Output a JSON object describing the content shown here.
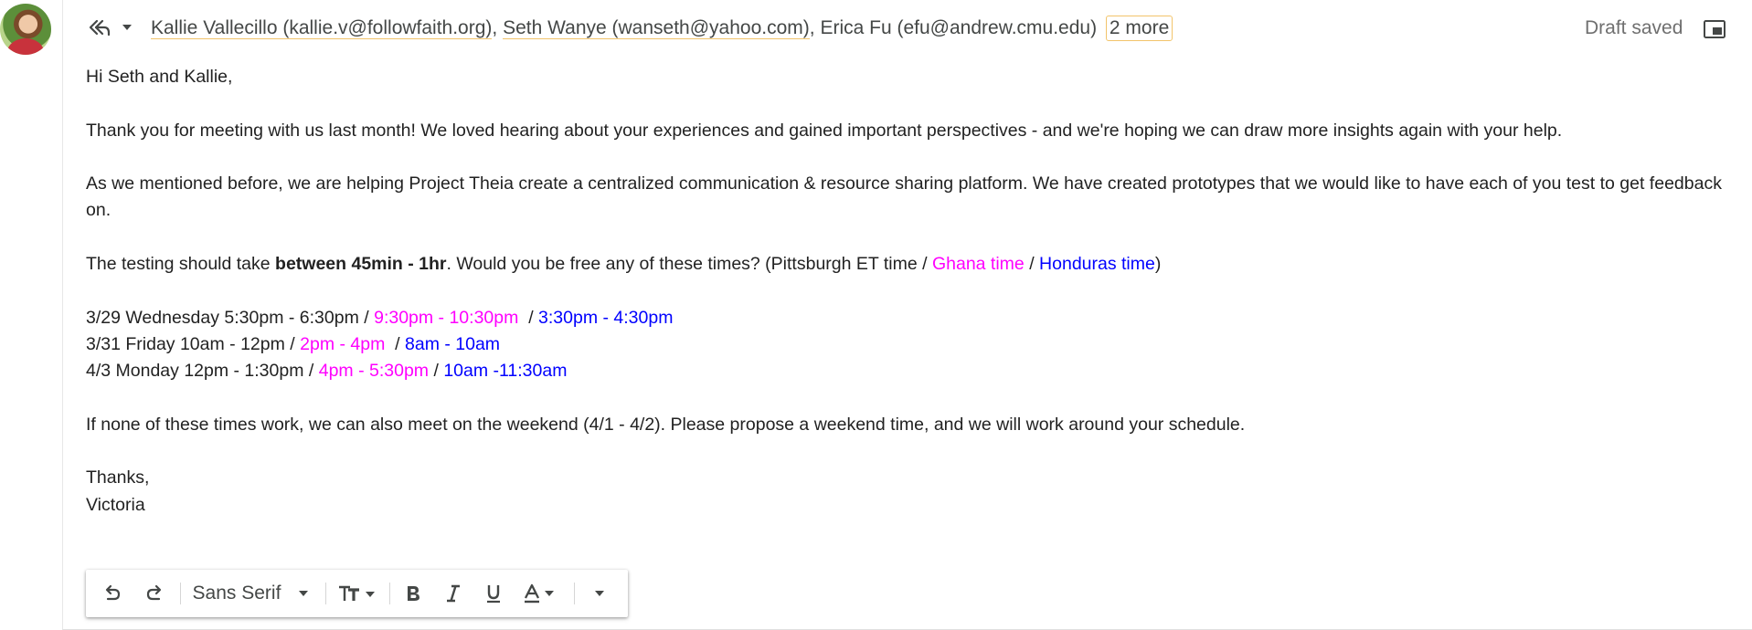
{
  "header": {
    "recipients": [
      {
        "name": "Kallie Vallecillo",
        "email": "kallie.v@followfaith.org",
        "display": "Kallie Vallecillo (kallie.v@followfaith.org)"
      },
      {
        "name": "Seth Wanye",
        "email": "wanseth@yahoo.com",
        "display": "Seth Wanye (wanseth@yahoo.com)"
      },
      {
        "name": "Erica Fu",
        "email": "efu@andrew.cmu.edu",
        "display": "Erica Fu (efu@andrew.cmu.edu)"
      }
    ],
    "separator": ", ",
    "more_label": "2 more",
    "status": "Draft saved"
  },
  "body": {
    "greeting": "Hi Seth and Kallie,",
    "p1": "Thank you for meeting with us last month! We loved hearing about your experiences and gained important perspectives - and we're hoping we can draw more insights again with your help.",
    "p2": "As we mentioned before, we are helping Project Theia create a centralized communication & resource sharing platform. We have created prototypes that we would like to have each of you test to get feedback on.",
    "p3": {
      "prefix": "The testing should take ",
      "bold": "between 45min - 1hr",
      "middle": ". Would you be free any of these times? (Pittsburgh ET time / ",
      "ghana": "Ghana time",
      "slash": " / ",
      "honduras": "Honduras time",
      "suffix": ")"
    },
    "slots": [
      {
        "et": "3/29 Wednesday 5:30pm - 6:30pm",
        "sep1": " / ",
        "ghana": "9:30pm - 10:30pm",
        "sep2": "  / ",
        "honduras": "3:30pm - 4:30pm"
      },
      {
        "et": "3/31 Friday 10am - 12pm",
        "sep1": " / ",
        "ghana": "2pm - 4pm",
        "sep2": "  / ",
        "honduras": "8am - 10am"
      },
      {
        "et": "4/3 Monday 12pm - 1:30pm",
        "sep1": " / ",
        "ghana": "4pm - 5:30pm",
        "sep2": " / ",
        "honduras": "10am -11:30am"
      }
    ],
    "p4": "If none of these times work, we can also meet on the weekend (4/1 - 4/2). Please propose a weekend time, and we will work around your schedule.",
    "closing": "Thanks,",
    "signature": "Victoria"
  },
  "toolbar": {
    "font_name": "Sans Serif"
  },
  "colors": {
    "ghana": "#ff00ff",
    "honduras": "#0000ff",
    "chip_underline": "#f2c46b"
  }
}
